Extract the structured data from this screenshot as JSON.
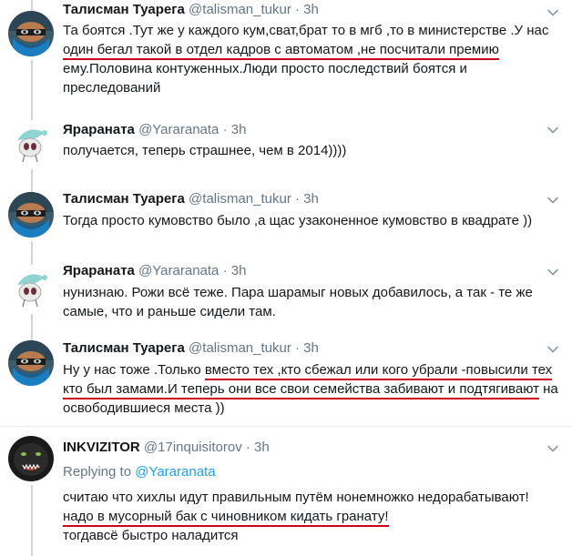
{
  "tweets": [
    {
      "name": "Талисман Туарега",
      "handle": "@talisman_tukur",
      "sep": "·",
      "time": "3h",
      "lines": [
        "Та боятся .Тут же у каждого кум,сват,брат то в мгб ,то в министерстве .У нас",
        "один бегал такой в отдел кадров с автоматом ,не посчитали премию",
        "ему.Половина контуженных.Люди просто последствий боятся и",
        "преследований"
      ]
    },
    {
      "name": "Ярараната",
      "handle": "@Yararanata",
      "sep": "·",
      "time": "3h",
      "lines": [
        "получается, теперь страшнее, чем в 2014))))"
      ]
    },
    {
      "name": "Талисман Туарега",
      "handle": "@talisman_tukur",
      "sep": "·",
      "time": "3h",
      "lines": [
        "Тогда просто кумовство было ,а щас узаконенное кумовство в квадрате ))"
      ]
    },
    {
      "name": "Ярараната",
      "handle": "@Yararanata",
      "sep": "·",
      "time": "3h",
      "lines": [
        "нунизнаю. Рожи всё теже. Пара шарамыг новых добавилось, а так - те же",
        "самые, что и раньше сидели там."
      ]
    },
    {
      "name": "Талисман Туарега",
      "handle": "@talisman_tukur",
      "sep": "·",
      "time": "3h",
      "l1a": "Ну у нас тоже .Только ",
      "l1b": "вместо тех ,кто сбежал или кого убрали -повысили тех",
      "l2a": "кто был замами.И теперь они все свои семейства забивают и подтягивают",
      "l2b": " на",
      "l3": "освободившиеся места ))"
    },
    {
      "name": "INKVIZITOR",
      "handle": "@17inquisitorov",
      "sep": "·",
      "time": "3h",
      "replying_label": "Replying to",
      "replying_to": "@Yararanata",
      "lines": [
        "считаю что хихлы идут правильным путём нонемножко недорабатывают!",
        "надо в мусорный бак с чиновником кидать гранату!",
        "тогдавсё быстро наладится"
      ]
    }
  ],
  "colors": {
    "name": "#14171a",
    "meta": "#657786",
    "link": "#1da1f2",
    "underline": "#d0021b",
    "thread": "#ccd6dd"
  }
}
